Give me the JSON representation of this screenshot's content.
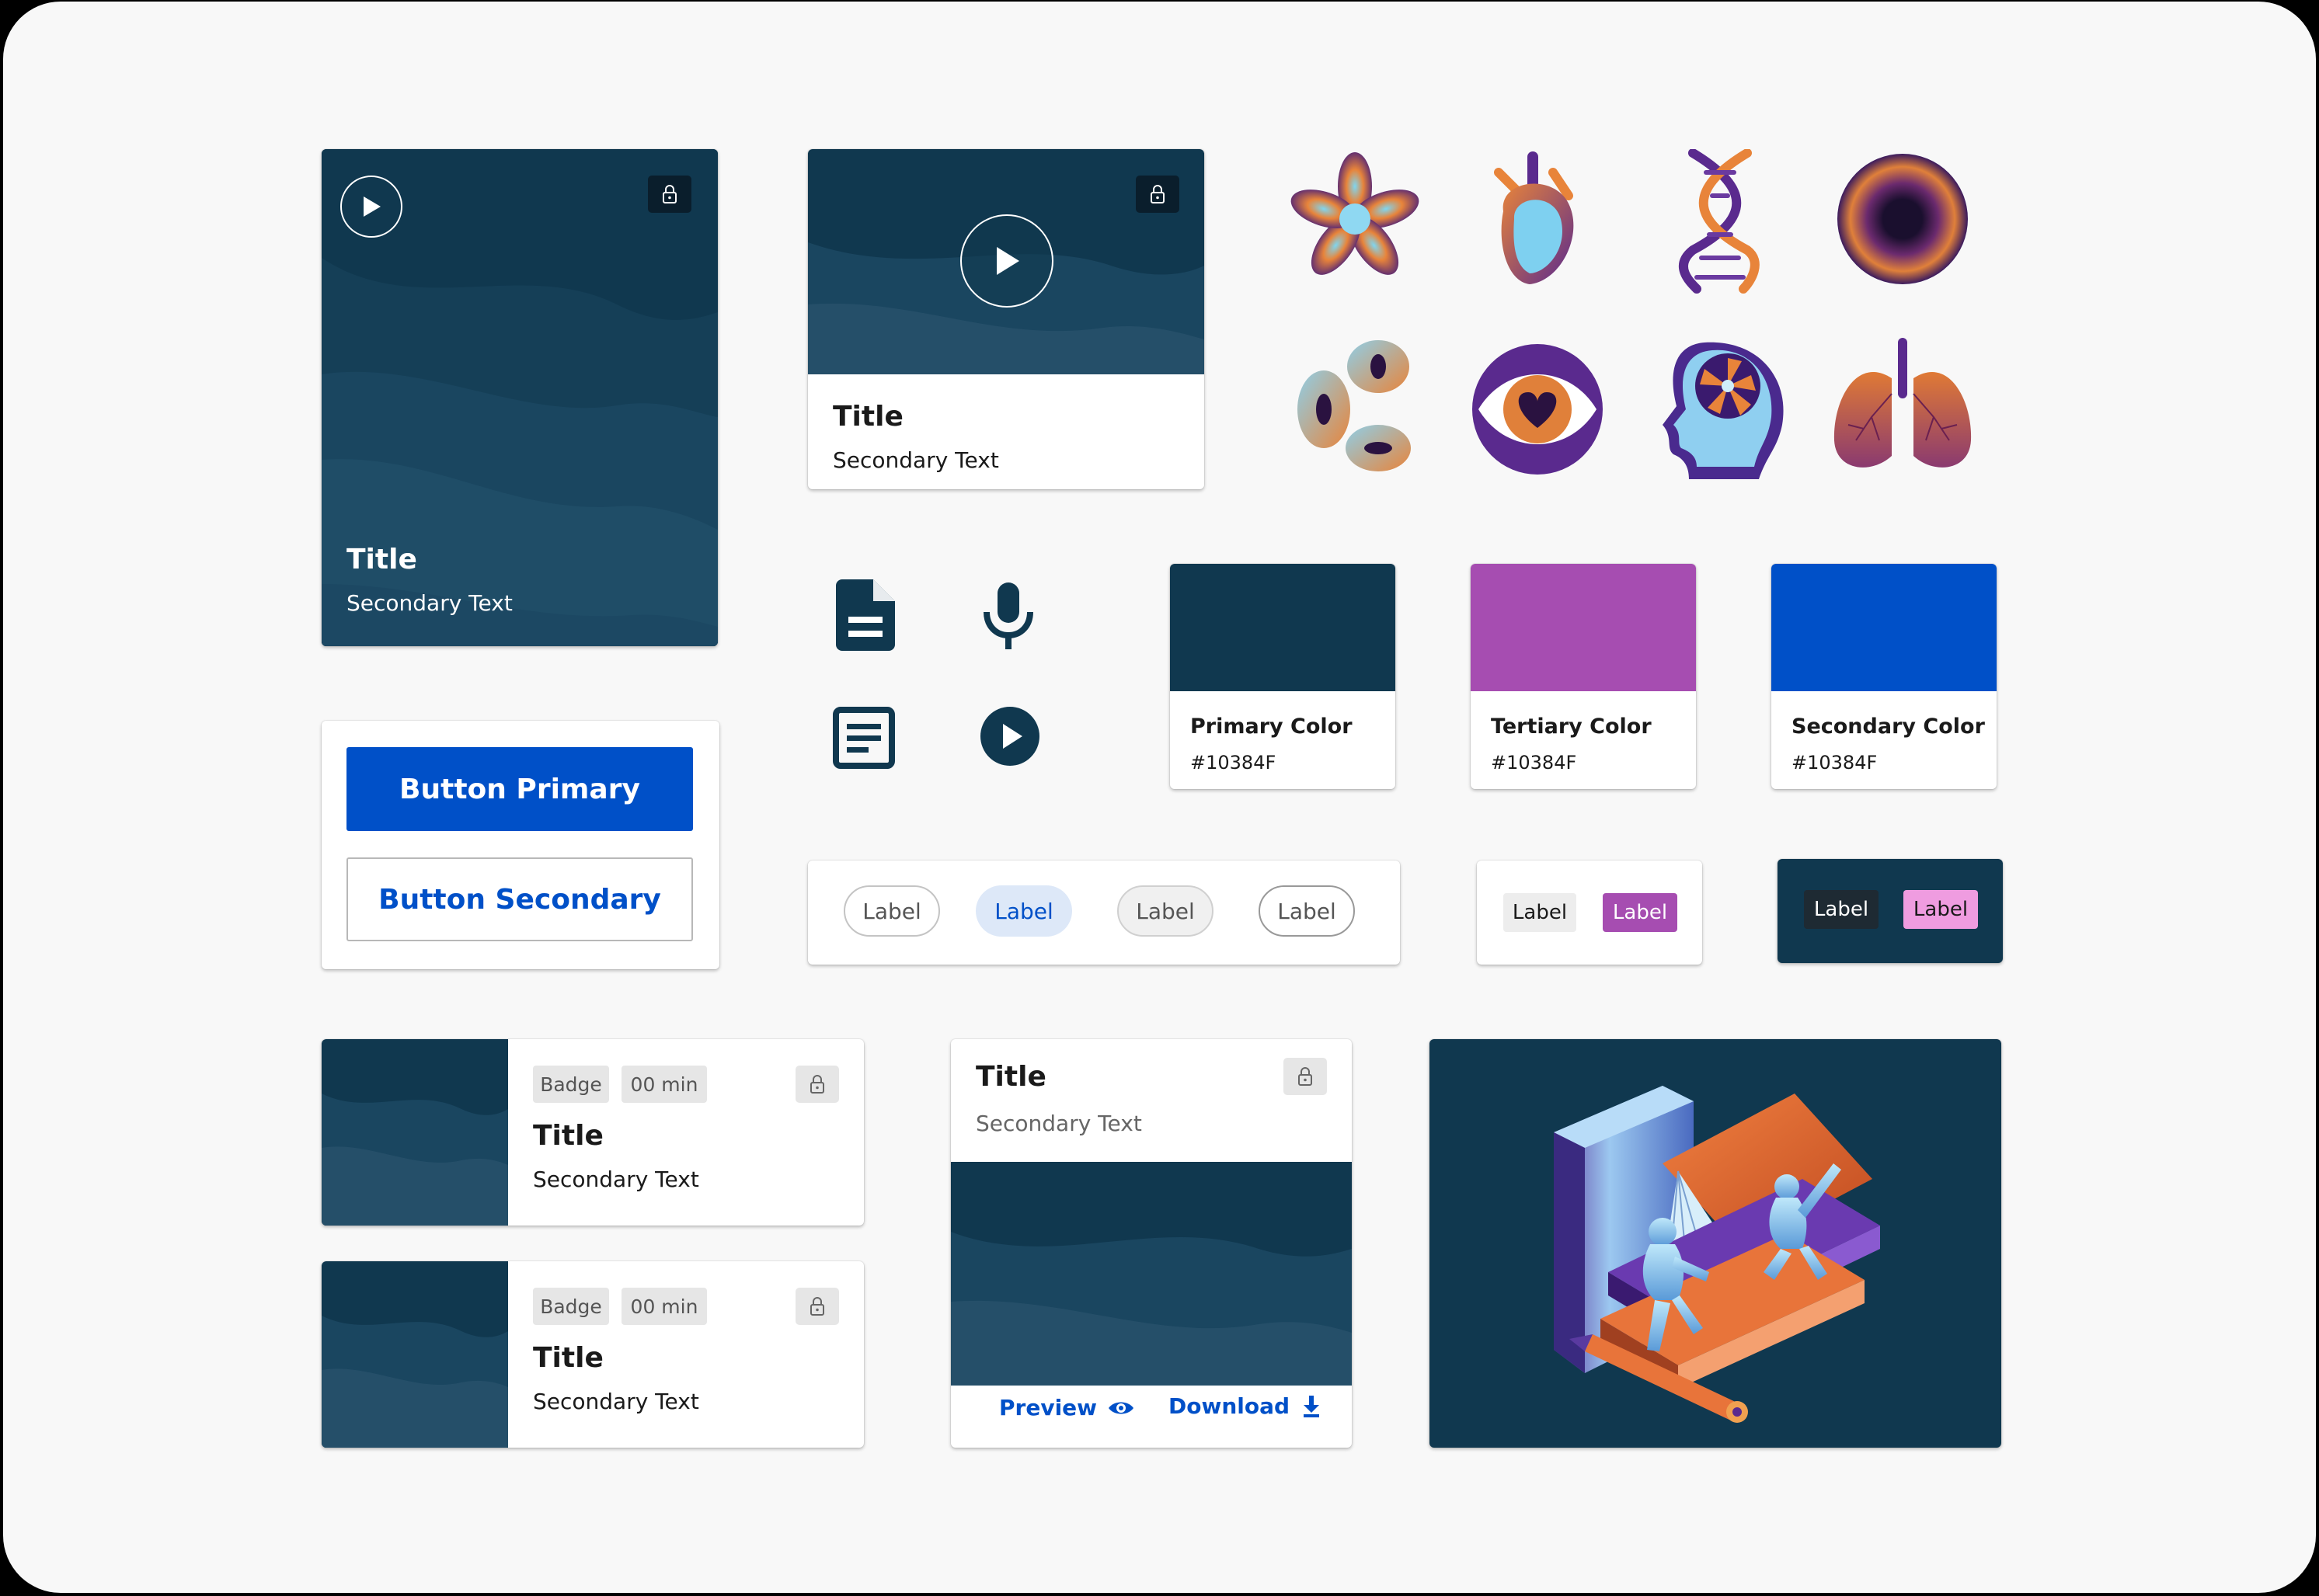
{
  "colors": {
    "background": "#f8f8f8",
    "primary_dark": "#10384f",
    "secondary_blue": "#0050c8",
    "tertiary_purple": "#a64db1",
    "label_pink": "#ef9ce0"
  },
  "video_card_tall": {
    "title": "Title",
    "secondary": "Secondary Text",
    "icons": [
      "play-icon",
      "lock-icon"
    ]
  },
  "video_card_wide": {
    "title": "Title",
    "secondary": "Secondary Text",
    "icons": [
      "play-icon",
      "lock-icon"
    ]
  },
  "illustrations": [
    "flower",
    "heart",
    "dna",
    "cell",
    "blood-cells",
    "eye-heart",
    "brain-head",
    "lungs"
  ],
  "icon_grid": [
    "document-icon",
    "microphone-icon",
    "article-icon",
    "play-circle-icon"
  ],
  "swatches": [
    {
      "name": "Primary Color",
      "hex": "#10384F",
      "color": "#10384f"
    },
    {
      "name": "Tertiary Color",
      "hex": "#10384F",
      "color": "#a64db1"
    },
    {
      "name": "Secondary Color",
      "hex": "#10384F",
      "color": "#0050c8"
    }
  ],
  "buttons": {
    "primary": "Button Primary",
    "secondary": "Button Secondary"
  },
  "chips": [
    "Label",
    "Label",
    "Label",
    "Label"
  ],
  "tags_light": [
    "Label",
    "Label"
  ],
  "tags_dark": [
    "Label",
    "Label"
  ],
  "list_cards": [
    {
      "badge": "Badge",
      "duration": "00 min",
      "title": "Title",
      "secondary": "Secondary Text"
    },
    {
      "badge": "Badge",
      "duration": "00 min",
      "title": "Title",
      "secondary": "Secondary Text"
    }
  ],
  "doc_card": {
    "title": "Title",
    "secondary": "Secondary Text",
    "preview": "Preview",
    "download": "Download"
  },
  "hero_illustration": "books-and-people"
}
